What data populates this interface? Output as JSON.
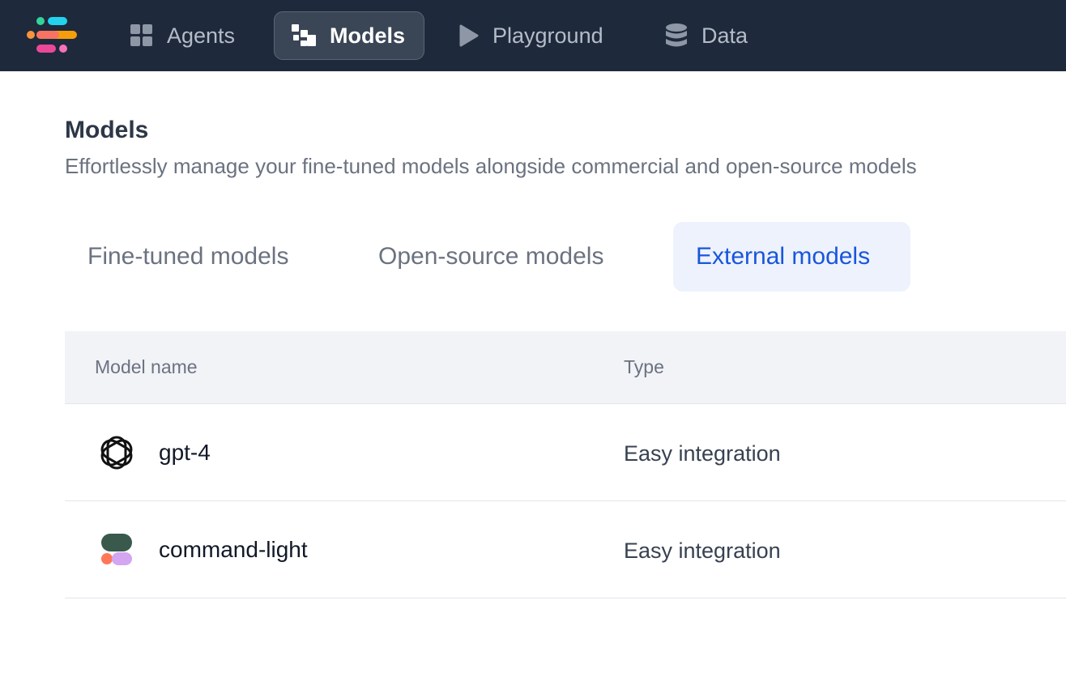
{
  "nav": {
    "items": [
      {
        "label": "Agents",
        "icon": "grid-icon",
        "active": false
      },
      {
        "label": "Models",
        "icon": "models-icon",
        "active": true
      },
      {
        "label": "Playground",
        "icon": "play-icon",
        "active": false
      },
      {
        "label": "Data",
        "icon": "database-icon",
        "active": false
      }
    ]
  },
  "page": {
    "title": "Models",
    "subtitle": "Effortlessly manage your fine-tuned models alongside commercial and open-source models"
  },
  "tabs": [
    {
      "label": "Fine-tuned models",
      "active": false
    },
    {
      "label": "Open-source models",
      "active": false
    },
    {
      "label": "External models",
      "active": true
    }
  ],
  "table": {
    "columns": [
      "Model name",
      "Type"
    ],
    "rows": [
      {
        "name": "gpt-4",
        "type": "Easy integration",
        "icon": "openai-logo-icon"
      },
      {
        "name": "command-light",
        "type": "Easy integration",
        "icon": "cohere-logo-icon"
      }
    ]
  },
  "colors": {
    "nav_bg": "#1e293b",
    "active_tab_bg": "#edf2fd",
    "active_tab_text": "#1a56db",
    "table_header_bg": "#f1f3f7"
  }
}
